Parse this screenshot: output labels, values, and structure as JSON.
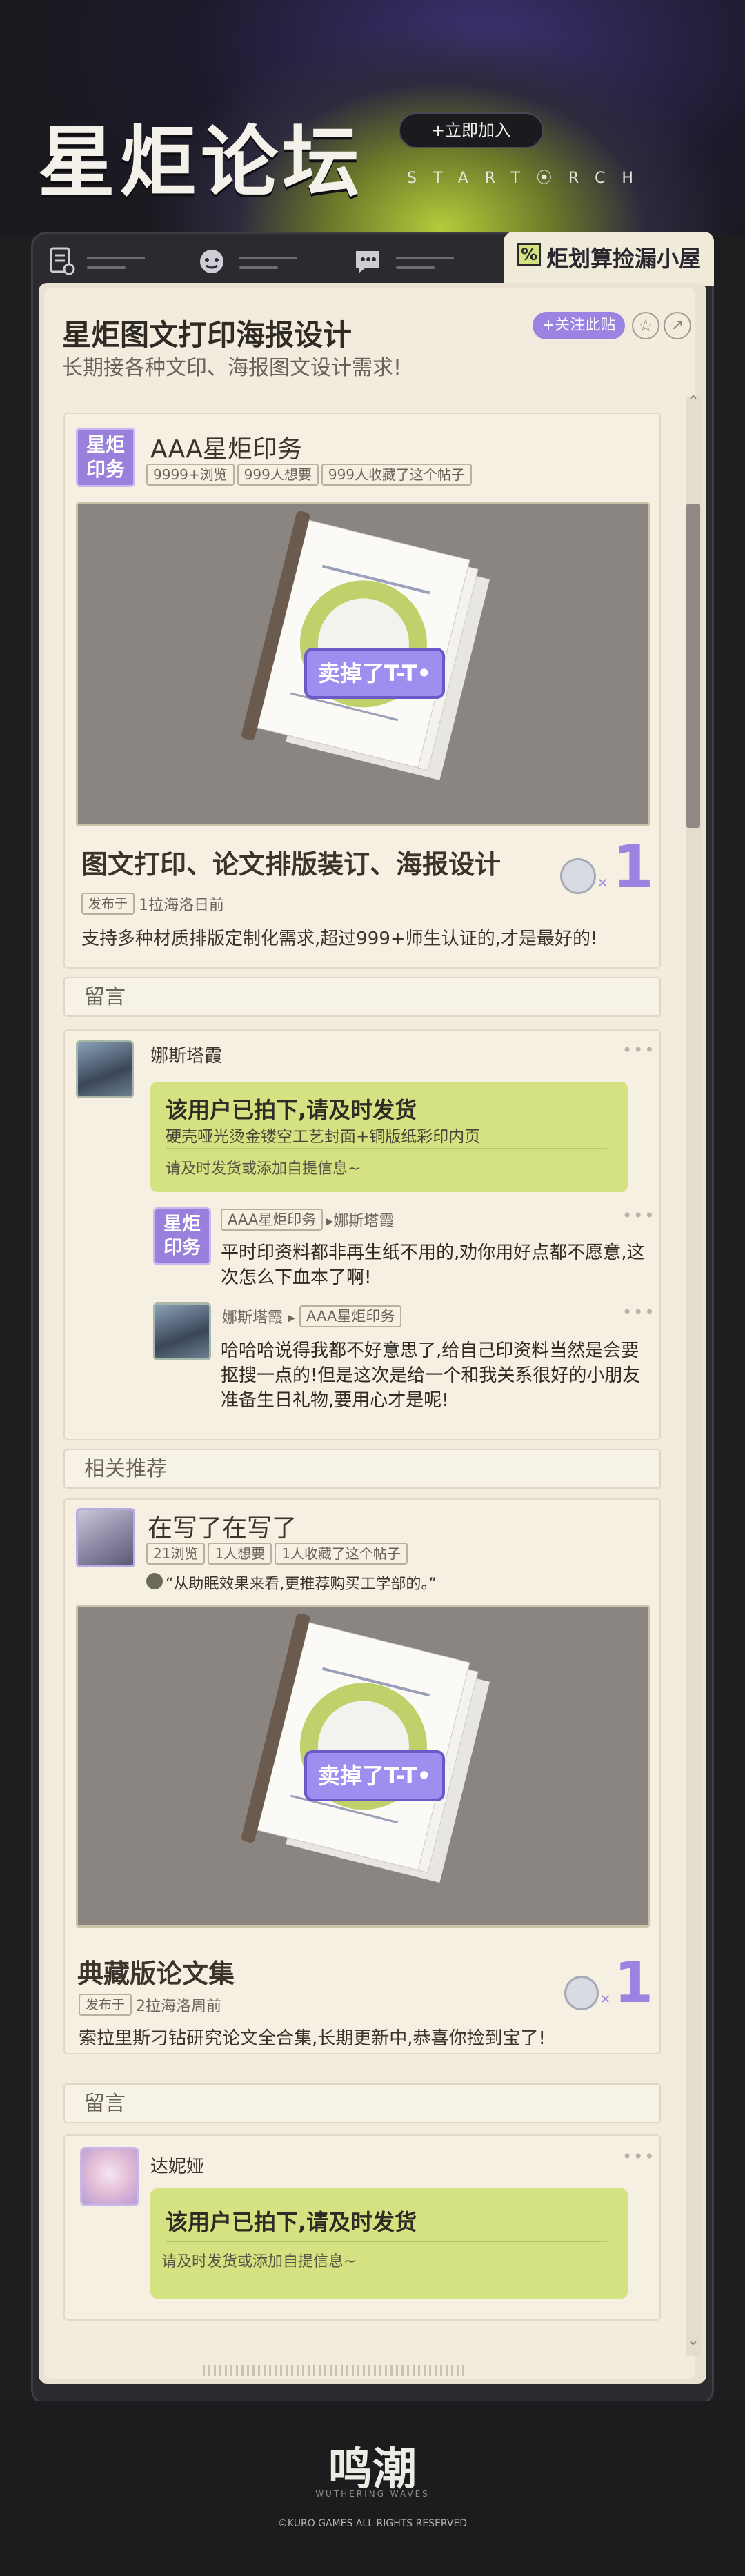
{
  "header": {
    "logo": "星炬论坛",
    "join_button": "+立即加入",
    "brand_en": "START⦿RCH"
  },
  "tabs": [
    {
      "icon": "document-icon",
      "label": ""
    },
    {
      "icon": "face-icon",
      "label": ""
    },
    {
      "icon": "chat-bubble-icon",
      "label": ""
    },
    {
      "icon": "tag-icon",
      "label": "炬划算捡漏小屋",
      "badge": "%"
    }
  ],
  "post": {
    "title": "星炬图文打印海报设计",
    "subtitle": "长期接各种文印、海报图文设计需求!",
    "follow_button": "+关注此贴",
    "listing": {
      "avatar_text": "星炬\n印务",
      "shop_name": "AAA星炬印务",
      "stats": [
        "9999+浏览",
        "999人想要",
        "999人收藏了这个帖子"
      ],
      "image_stamp": "卖掉了T-T•",
      "item_title": "图文打印、论文排版装订、海报设计",
      "price": "1",
      "price_mark": "x",
      "posted_tag": "发布于",
      "posted_time": "1拉海洛日前",
      "description": "支持多种材质排版定制化需求,超过999+师生认证的,才是最好的!"
    }
  },
  "comments1": {
    "section_label": "留言",
    "main_user": "娜斯塔霞",
    "notice_title": "该用户已拍下,请及时发货",
    "notice_item": "硬壳哑光烫金镂空工艺封面+铜版纸彩印内页",
    "notice_hint": "请及时发货或添加自提信息~",
    "replies": [
      {
        "avatar_text": "星炬\n印务",
        "from": "AAA星炬印务",
        "to": "▸娜斯塔霞",
        "text": "平时印资料都非再生纸不用的,劝你用好点都不愿意,这次怎么下血本了啊!"
      },
      {
        "from": "娜斯塔霞 ▸",
        "to": "AAA星炬印务",
        "text": "哈哈哈说得我都不好意思了,给自己印资料当然是会要抠搜一点的!但是这次是给一个和我关系很好的小朋友准备生日礼物,要用心才是呢!"
      }
    ]
  },
  "related": {
    "section_label": "相关推荐",
    "user_title": "在写了在写了",
    "stats": [
      "21浏览",
      "1人想要",
      "1人收藏了这个帖子"
    ],
    "quote": "“从助眠效果来看,更推荐购买工学部的。”",
    "image_stamp": "卖掉了T-T•",
    "item_title": "典藏版论文集",
    "price": "1",
    "posted_tag": "发布于",
    "posted_time": "2拉海洛周前",
    "description": "索拉里斯刁钻研究论文全合集,长期更新中,恭喜你捡到宝了!"
  },
  "comments2": {
    "section_label": "留言",
    "main_user": "达妮娅",
    "notice_title": "该用户已拍下,请及时发货",
    "notice_hint": "请及时发货或添加自提信息~"
  },
  "footer": {
    "brand": "鸣潮",
    "brand_en": "WUTHERING WAVES",
    "copyright": "©KURO GAMES ALL RIGHTS RESERVED"
  }
}
